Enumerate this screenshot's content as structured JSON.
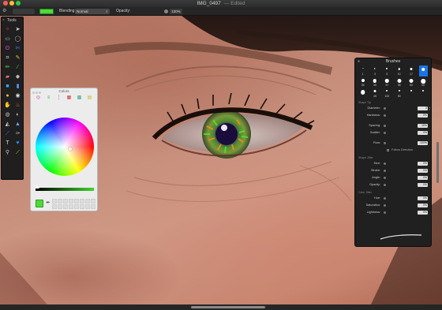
{
  "window": {
    "title": "IMG_0497",
    "edited": "— Edited"
  },
  "options_bar": {
    "blending_label": "Blending:",
    "blending_value": "Normal",
    "opacity_label": "Opacity:",
    "opacity_value": "100%",
    "brush_color": "#4ddb3a"
  },
  "tools_panel": {
    "title": "Tools",
    "tools": [
      {
        "icon": "magic-wand-icon",
        "glyph": "✧",
        "color": "#d33"
      },
      {
        "icon": "pointer-icon",
        "glyph": "➤",
        "color": "#ddd"
      },
      {
        "icon": "rect-select-icon",
        "glyph": "▭",
        "color": "#bbb"
      },
      {
        "icon": "ellipse-select-icon",
        "glyph": "◯",
        "color": "#bbb"
      },
      {
        "icon": "lasso-icon",
        "glyph": "ʘ",
        "color": "#c4c"
      },
      {
        "icon": "magic-lasso-icon",
        "glyph": "✄",
        "color": "#48f"
      },
      {
        "icon": "crop-icon",
        "glyph": "⌗",
        "color": "#ddd"
      },
      {
        "icon": "eyedropper-icon",
        "glyph": "✎",
        "color": "#eb4"
      },
      {
        "icon": "paint-brush-icon",
        "glyph": "✏",
        "color": "#6c4"
      },
      {
        "icon": "brush-alt-icon",
        "glyph": "⁄",
        "color": "#6c4"
      },
      {
        "icon": "eraser-icon",
        "glyph": "▰",
        "color": "#e66"
      },
      {
        "icon": "fill-bucket-icon",
        "glyph": "◆",
        "color": "#bbb"
      },
      {
        "icon": "shape-icon",
        "glyph": "■",
        "color": "#3af"
      },
      {
        "icon": "gradient-icon",
        "glyph": "▮",
        "color": "#59f"
      },
      {
        "icon": "clone-icon",
        "glyph": "●",
        "color": "#fb3"
      },
      {
        "icon": "heal-icon",
        "glyph": "◉",
        "color": "#ddd"
      },
      {
        "icon": "smudge-icon",
        "glyph": "✋",
        "color": "#e92"
      },
      {
        "icon": "burn-icon",
        "glyph": "♨",
        "color": "#f63"
      },
      {
        "icon": "red-eye-icon",
        "glyph": "◍",
        "color": "#bbb"
      },
      {
        "icon": "dodge-icon",
        "glyph": "◐",
        "color": "#ccc"
      },
      {
        "icon": "sponge-icon",
        "glyph": "◭",
        "color": "#ddd"
      },
      {
        "icon": "blur-icon",
        "glyph": "▲",
        "color": "#6af"
      },
      {
        "icon": "sharpen-icon",
        "glyph": "⟋",
        "color": "#48f"
      },
      {
        "icon": "pen-icon",
        "glyph": "✑",
        "color": "#ccc"
      },
      {
        "icon": "text-icon",
        "glyph": "T",
        "color": "#ddd"
      },
      {
        "icon": "heart-shape-icon",
        "glyph": "♥",
        "color": "#29f"
      },
      {
        "icon": "zoom-icon",
        "glyph": "⚲",
        "color": "#ccc"
      },
      {
        "icon": "hand-brush-icon",
        "glyph": "⟋",
        "color": "#ec3"
      }
    ]
  },
  "colors_panel": {
    "title": "Colors",
    "tabs": [
      {
        "icon": "color-wheel-tab-icon",
        "glyph": "◎",
        "color": "#d4a"
      },
      {
        "icon": "rgb-sliders-tab-icon",
        "glyph": "≡",
        "color": "#4a4"
      },
      {
        "icon": "cmyk-tab-icon",
        "glyph": "⋮",
        "color": "#555"
      },
      {
        "icon": "palette-tab-icon",
        "glyph": "▦",
        "color": "#c33"
      },
      {
        "icon": "crayons-tab-icon",
        "glyph": "▩",
        "color": "#3a8"
      },
      {
        "icon": "image-tab-icon",
        "glyph": "▤",
        "color": "#bb3"
      }
    ],
    "current_color": "#4ddb3a"
  },
  "brushes_panel": {
    "title": "Brushes",
    "sizes": [
      {
        "label": "1",
        "dot": 1
      },
      {
        "label": "3",
        "dot": 1.5
      },
      {
        "label": "5",
        "dot": 2
      },
      {
        "label": "10",
        "dot": 2.5
      },
      {
        "label": "17",
        "dot": 3
      },
      {
        "label": "",
        "dot": 3.5,
        "selected": true
      },
      {
        "label": "28",
        "dot": 4
      },
      {
        "label": "35",
        "dot": 4.5
      },
      {
        "label": "37",
        "dot": 4.5
      },
      {
        "label": "38",
        "dot": 5
      },
      {
        "label": "50",
        "dot": 5
      },
      {
        "label": "60",
        "dot": 5.5
      },
      {
        "label": "",
        "dot": 5.5
      },
      {
        "label": "45",
        "dot": 3
      },
      {
        "label": "100",
        "dot": 2
      },
      {
        "label": "90",
        "dot": 2
      },
      {
        "label": "",
        "dot": 2
      },
      {
        "label": "",
        "dot": 2
      }
    ],
    "shape_tip": {
      "label": "Shape Tip",
      "diameter_label": "Diameter:",
      "diameter_value": "3",
      "hardness_label": "Hardness:",
      "hardness_value": "0%",
      "spacing_label": "Spacing:",
      "spacing_value": "15%",
      "scatter_label": "Scatter:",
      "scatter_value": "0%",
      "flow_label": "Flow:",
      "flow_value": "100%",
      "follow_direction": "Follow Direction"
    },
    "shape_jitter": {
      "label": "Shape Jitter",
      "size_label": "Size:",
      "size_value": "0%",
      "stroke_label": "Stroke:",
      "stroke_value": "0%",
      "angle_label": "Angle:",
      "angle_value": "0%",
      "opacity_label": "Opacity:",
      "opacity_value": "0%"
    },
    "color_jitter": {
      "label": "Color Jitter",
      "hue_label": "Hue:",
      "hue_value": "0%",
      "saturation_label": "Saturation:",
      "saturation_value": "0%",
      "lightness_label": "Lightness:",
      "lightness_value": "0%"
    }
  }
}
